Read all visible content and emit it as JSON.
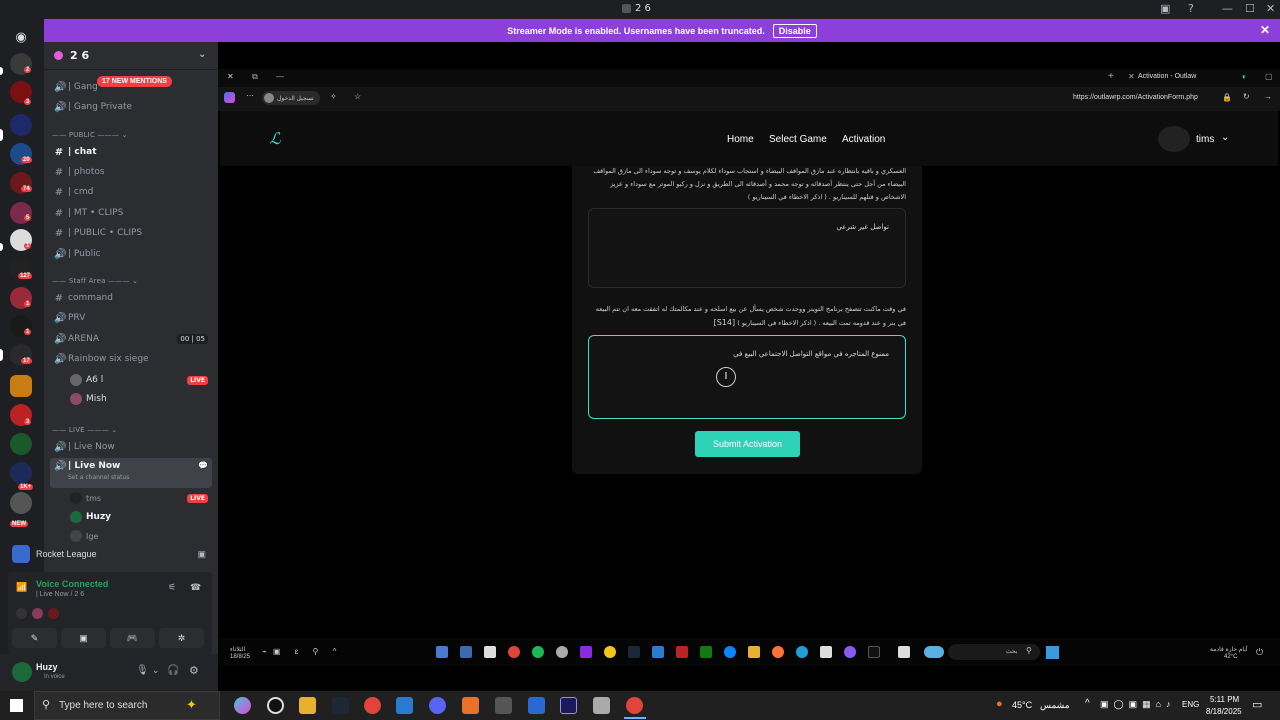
{
  "titlebar": {
    "title": "2 6"
  },
  "banner": {
    "text": "Streamer Mode is enabled. Usernames have been truncated.",
    "button": "Disable"
  },
  "rail": {
    "badges": [
      "2",
      "3",
      "20",
      "74",
      "5",
      "1",
      "127",
      "1",
      "1",
      "17",
      "3",
      "1K+",
      "NEW"
    ]
  },
  "guild": {
    "name": "2 6"
  },
  "channels": {
    "mention_pill": "17 NEW MENTIONS",
    "items": [
      {
        "label": "| Gang",
        "icon": "speaker"
      },
      {
        "label": "| Gang Private",
        "icon": "speaker"
      },
      {
        "label": "PUBLIC",
        "type": "category"
      },
      {
        "label": "| chat",
        "icon": "hash"
      },
      {
        "label": "| photos",
        "icon": "hash"
      },
      {
        "label": "| cmd",
        "icon": "hash"
      },
      {
        "label": "| MT • CLIPS",
        "icon": "hash"
      },
      {
        "label": "| PUBLIC • CLIPS",
        "icon": "hash"
      },
      {
        "label": "| Public",
        "icon": "speaker"
      },
      {
        "label": "Staff Area",
        "type": "category"
      },
      {
        "label": "command",
        "icon": "hash"
      },
      {
        "label": "PRV",
        "icon": "speaker"
      },
      {
        "label": "ARENA",
        "icon": "speaker",
        "counter": "00 | 05"
      },
      {
        "label": "Rainbow six siege",
        "icon": "speaker"
      },
      {
        "label": "A6 l",
        "type": "member",
        "live": "LIVE"
      },
      {
        "label": "Mish",
        "type": "member"
      },
      {
        "label": "LIVE",
        "type": "category"
      },
      {
        "label": "| Live Now",
        "icon": "speaker"
      },
      {
        "label": "| Live Now",
        "icon": "speaker",
        "status": "Set a channel status"
      },
      {
        "label": "tms",
        "type": "member",
        "live": "LIVE"
      },
      {
        "label": "Huzy",
        "type": "member"
      },
      {
        "label": "Ige",
        "type": "member"
      }
    ]
  },
  "activity": {
    "game": "Rocket League"
  },
  "voice": {
    "status": "Voice Connected",
    "channel": "| Live Now / 2 6"
  },
  "user": {
    "name": "Huzy",
    "status": "In voice"
  },
  "browser": {
    "tab_title": "Activation - Outlaw",
    "signin": "تسجيل الدخول",
    "url": "https://outlawrp.com/ActivationForm.php"
  },
  "site": {
    "nav": [
      "Home",
      "Select Game",
      "Activation"
    ],
    "username": "tims",
    "question1": "العسكري و باقيه بانتظاره عند مازق المواقف البيضاء و استجاب سوداء لكلام يوسف و توجه سوداء الى مازق المواقف البيضاء من أجل حتى ينتظر أصدقائه و توجه محمد و أصدقائه الى الطريق و نزل و ركبو الموتر مع سوداء و عزيز الاشخاص و قتلهم للسيناريو . ( اذكر الاخطاء في السيناريو )",
    "answer1": "تواصل غير شرعي",
    "question2": "في وقت ماكنت تتصفح برنامج التويتر ووجدت شخص يسأل عن بيع اسلحه و عند مكالمتك له اتفقت معه ان تتم البيعه في بنر و عند قدومه تمت البيعه . ( اذكر الاخطاء في السيناريو )",
    "question2_tag": "[S14]",
    "answer2": "ممنوع المتاجره في مواقع التواصل الاجتماعي البيع في",
    "submit": "Submit Activation"
  },
  "overlay": {
    "left_time": "الثلاثاء",
    "left_date": "18/8/25",
    "search": "بحث",
    "weather": "أيام حارة قادمة",
    "temp": "42°C"
  },
  "taskbar": {
    "search_placeholder": "Type here to search",
    "weather_temp": "45°C",
    "weather_desc": "مشمس",
    "lang": "ENG",
    "time": "5:11 PM",
    "date": "8/18/2025"
  },
  "colors": {
    "accent": "#2ed3b7",
    "banner": "#8c3fd9",
    "discord_bg": "#2b2d31",
    "rail_bg": "#1e1f22",
    "live_red": "#f23f43",
    "voice_green": "#23a55a"
  }
}
